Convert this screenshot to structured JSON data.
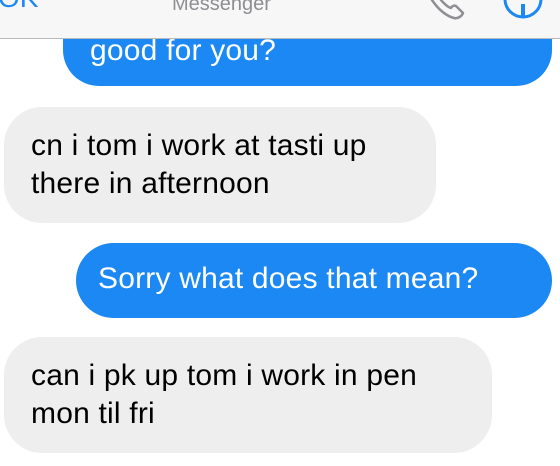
{
  "header": {
    "back_label": "OK",
    "subtitle": "Messenger",
    "call_icon": "phone-icon",
    "info_icon": "info-icon"
  },
  "colors": {
    "outgoing_bubble": "#1c88f4",
    "incoming_bubble": "#eeeeef",
    "nav_background": "#f7f7f8",
    "accent": "#1c88f4"
  },
  "messages": [
    {
      "direction": "outgoing",
      "lines": [
        "good for you?"
      ]
    },
    {
      "direction": "incoming",
      "lines": [
        "cn i tom i work at tasti up",
        "there in afternoon"
      ]
    },
    {
      "direction": "outgoing",
      "lines": [
        "Sorry what does that mean?"
      ]
    },
    {
      "direction": "incoming",
      "lines": [
        "can i pk up tom i work in pen",
        "mon til fri"
      ]
    }
  ]
}
